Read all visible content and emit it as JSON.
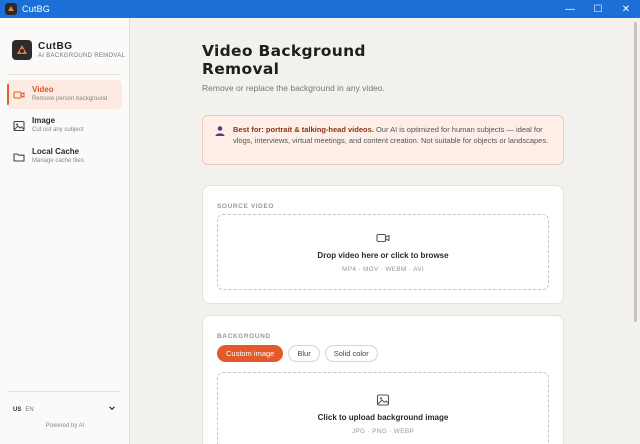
{
  "window": {
    "title": "CutBG",
    "controls": {
      "minimize": "—",
      "maximize": "☐",
      "close": "✕"
    }
  },
  "sidebar": {
    "brand": {
      "name": "CutBG",
      "tagline": "AI BACKGROUND REMOVAL",
      "logo_icon": "cutbg-logo-icon"
    },
    "items": [
      {
        "label": "Video",
        "sub": "Remove person background",
        "icon": "video-icon",
        "active": true
      },
      {
        "label": "Image",
        "sub": "Cut out any subject",
        "icon": "image-icon",
        "active": false
      },
      {
        "label": "Local Cache",
        "sub": "Manage cache files",
        "icon": "folder-icon",
        "active": false
      }
    ],
    "language": {
      "flag": "US",
      "code": "EN"
    },
    "powered_by": "Powered by AI"
  },
  "main": {
    "title_line1": "Video Background",
    "title_line2": "Removal",
    "subtitle": "Remove or replace the background in any video.",
    "notice": {
      "bold": "Best for: portrait & talking-head videos.",
      "text": " Our AI is optimized for human subjects — ideal for vlogs, interviews, virtual meetings, and content creation. Not suitable for objects or landscapes."
    },
    "source": {
      "caption": "SOURCE VIDEO",
      "drop_text": "Drop video here or click to browse",
      "formats": "MP4 · MOV · WEBM · AVI"
    },
    "background": {
      "caption": "BACKGROUND",
      "options": [
        "Custom image",
        "Blur",
        "Solid color"
      ],
      "selected": "Custom image",
      "drop_text": "Click to upload background image",
      "formats": "JPG · PNG · WEBP"
    }
  },
  "colors": {
    "accent": "#e2592a",
    "titlebar": "#1c6fd6",
    "notice_bg": "#fdeee7"
  }
}
